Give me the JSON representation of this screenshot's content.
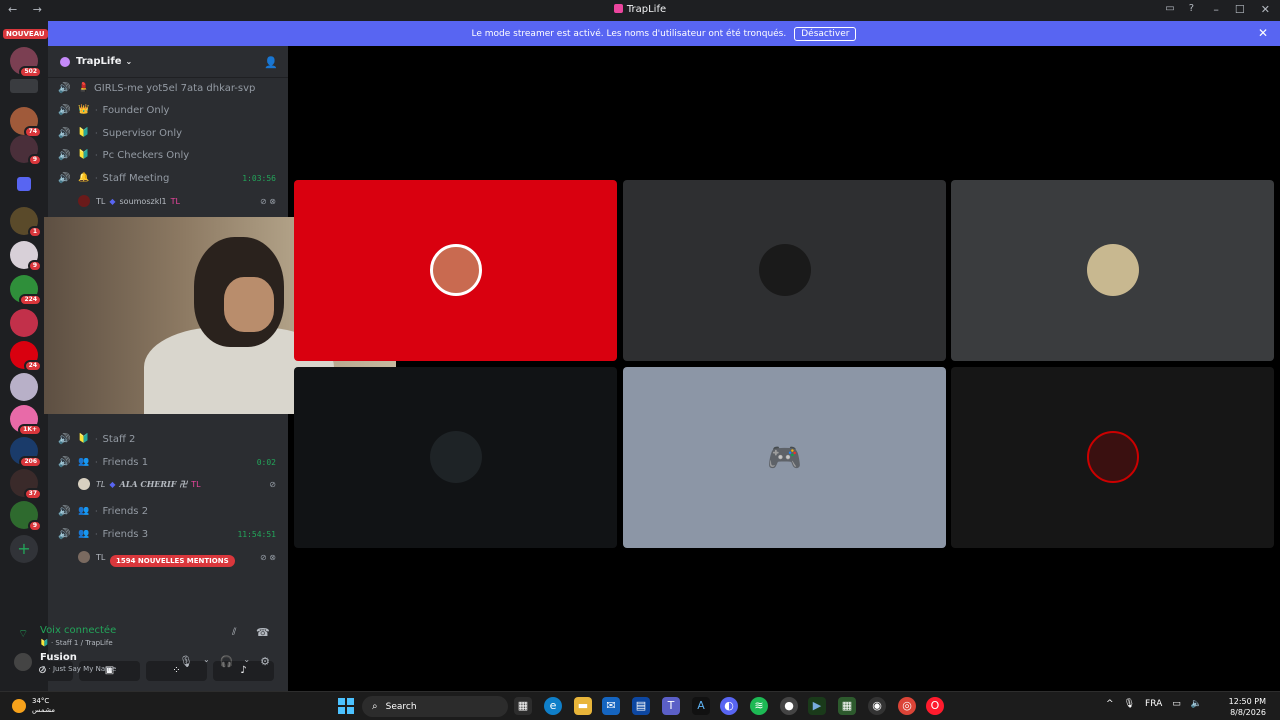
{
  "window": {
    "title": "TrapLife",
    "nav_glyphs": "← →"
  },
  "servers": {
    "nouveau_label": "NOUVEAU",
    "badges": [
      "502",
      "74",
      "9",
      "1",
      "9",
      "224",
      "24",
      "1K+",
      "206",
      "37",
      "9"
    ]
  },
  "banner": {
    "text": "Le mode streamer est activé. Les noms d'utilisateur ont été tronqués.",
    "button": "Désactiver"
  },
  "guild": {
    "name": "TrapLife",
    "channels": [
      {
        "emoji": "💄",
        "name": "GIRLS-me yot5el 7ata dhkar-svp",
        "time": ""
      },
      {
        "emoji": "👑",
        "name": "Founder Only",
        "time": ""
      },
      {
        "emoji": "🔰",
        "name": "Supervisor Only",
        "time": ""
      },
      {
        "emoji": "🔰",
        "name": "Pc Checkers Only",
        "time": ""
      },
      {
        "emoji": "🔔",
        "name": "Staff Meeting",
        "time": "1:03:56"
      },
      {
        "emoji": "🔰",
        "name": "Staff 2",
        "time": ""
      },
      {
        "emoji": "👥",
        "name": "Friends 1",
        "time": "0:02"
      },
      {
        "emoji": "👥",
        "name": "Friends 2",
        "time": ""
      },
      {
        "emoji": "👥",
        "name": "Friends 3",
        "time": "11:54:51"
      }
    ],
    "users": [
      {
        "prefix": "TL",
        "name": "soumoszkl1",
        "tag": "TL"
      },
      {
        "prefix": "TL",
        "name": "ALA CHERIF 卍",
        "tag": "TL"
      },
      {
        "prefix": "TL",
        "name": "",
        "tag": ""
      }
    ],
    "mentions": "1594 NOUVELLES MENTIONS"
  },
  "voice": {
    "status": "Voix connectée",
    "channel": "Staff 1 / TrapLife"
  },
  "account": {
    "name": "Fusion",
    "status": "Just Say My Name"
  },
  "stage": {
    "tile_colors": [
      "#d9000f",
      "#2e2f31",
      "#3a3c3e",
      "#111315",
      "#8c96a6",
      "#161616"
    ]
  },
  "taskbar": {
    "temperature": "34°C",
    "weather": "مشمس",
    "search_placeholder": "Search",
    "language": "FRA",
    "time": "12:50 PM",
    "date": "8/8/2026"
  }
}
